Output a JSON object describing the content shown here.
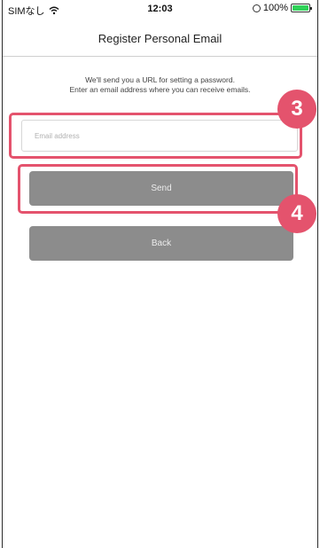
{
  "status_bar": {
    "carrier": "SIMなし",
    "time": "12:03",
    "battery": "100%",
    "battery_level": 1.0
  },
  "nav": {
    "title": "Register Personal Email"
  },
  "instructions": {
    "line1": "We'll send you a URL for setting a password.",
    "line2": "Enter an email address where you can receive emails."
  },
  "form": {
    "email_placeholder": "Email address",
    "email_value": ""
  },
  "buttons": {
    "send_label": "Send",
    "back_label": "Back"
  },
  "callouts": {
    "step3": "3",
    "step4": "4",
    "accent_color": "#e4536d"
  },
  "colors": {
    "button_gray": "#8c8c8c",
    "battery_green": "#2fd158"
  },
  "icons": [
    "wifi-icon",
    "orientation-lock-icon",
    "battery-icon"
  ]
}
